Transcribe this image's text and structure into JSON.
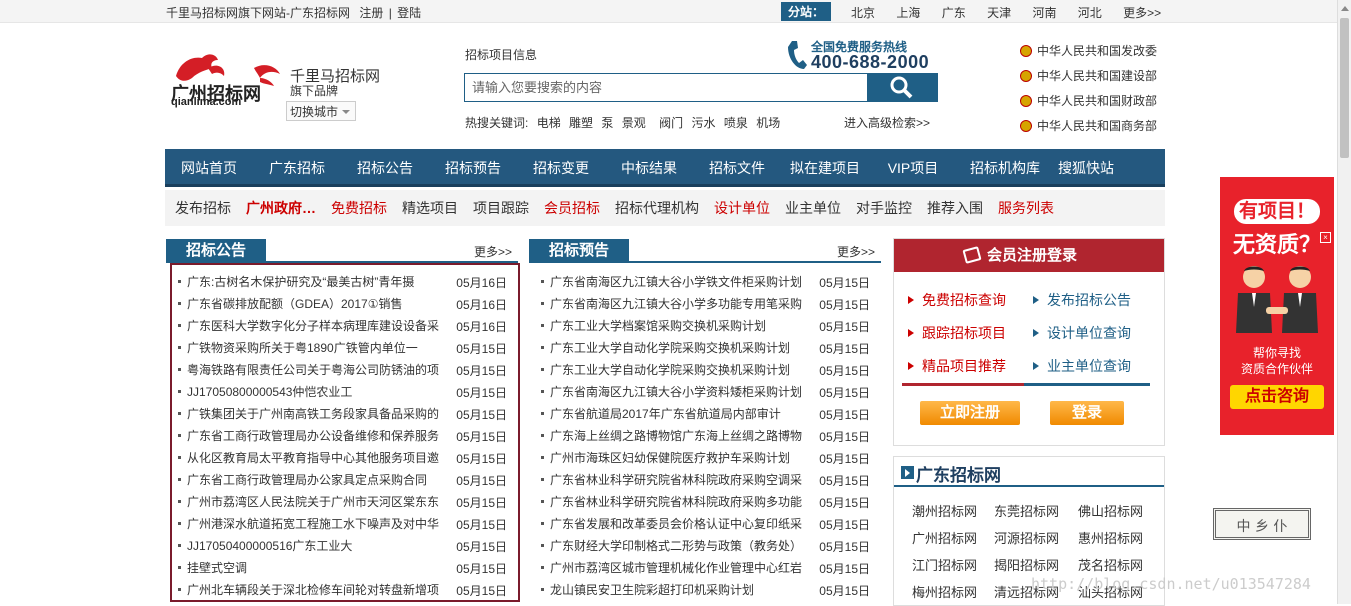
{
  "topbar": {
    "site_desc": "千里马招标网旗下网站-广东招标网",
    "register": "注册",
    "sep": "|",
    "login": "登陆",
    "branch_label": "分站：",
    "cities": [
      "北京",
      "上海",
      "广东",
      "天津",
      "河南",
      "河北"
    ],
    "more": "更多>>"
  },
  "header": {
    "logo_text": "广州招标网",
    "logo_domain": "qianlima.com",
    "brand_name": "千里马招标网",
    "brand_sub": "旗下品牌",
    "switch_city": "切换城市",
    "search_label": "招标项目信息",
    "search_placeholder": "请输入您要搜索的内容",
    "hot_label": "热搜关键词:",
    "hot_keywords": [
      "电梯",
      "雕塑",
      "泵",
      "景观",
      "阀门",
      "污水",
      "喷泉",
      "机场"
    ],
    "advanced_search": "进入高级检索>>",
    "hotline_title": "全国免费服务热线",
    "hotline_number": "400-688-2000",
    "gov_links": [
      "中华人民共和国发改委",
      "中华人民共和国建设部",
      "中华人民共和国财政部",
      "中华人民共和国商务部"
    ]
  },
  "main_nav": [
    "网站首页",
    "广东招标",
    "招标公告",
    "招标预告",
    "招标变更",
    "中标结果",
    "招标文件",
    "拟在建项目",
    "VIP项目",
    "招标机构库",
    "搜狐快站"
  ],
  "sub_nav": [
    {
      "label": "发布招标",
      "style": "normal"
    },
    {
      "label": "广州政府…",
      "style": "red-bold"
    },
    {
      "label": "免费招标",
      "style": "red"
    },
    {
      "label": "精选项目",
      "style": "normal"
    },
    {
      "label": "项目跟踪",
      "style": "normal"
    },
    {
      "label": "会员招标",
      "style": "red"
    },
    {
      "label": "招标代理机构",
      "style": "normal"
    },
    {
      "label": "设计单位",
      "style": "red"
    },
    {
      "label": "业主单位",
      "style": "normal"
    },
    {
      "label": "对手监控",
      "style": "normal"
    },
    {
      "label": "推荐入围",
      "style": "normal"
    },
    {
      "label": "服务列表",
      "style": "red"
    }
  ],
  "announcements": {
    "title": "招标公告",
    "more": "更多>>",
    "items": [
      {
        "title": "广东:古树名木保护研究及“最美古树”青年摄",
        "date": "05月16日"
      },
      {
        "title": "广东省碳排放配额（GDEA）2017①销售",
        "date": "05月16日"
      },
      {
        "title": "广东医科大学数字化分子样本病理库建设设备采",
        "date": "05月16日"
      },
      {
        "title": "广铁物资采购所关于粤1890广铁管内单位一",
        "date": "05月15日"
      },
      {
        "title": "粤海铁路有限责任公司关于粤海公司防锈油的项",
        "date": "05月15日"
      },
      {
        "title": "JJ17050800000543仲恺农业工",
        "date": "05月15日"
      },
      {
        "title": "广铁集团关于广州南高铁工务段家具备品采购的",
        "date": "05月15日"
      },
      {
        "title": "广东省工商行政管理局办公设备维修和保养服务",
        "date": "05月15日"
      },
      {
        "title": "从化区教育局太平教育指导中心其他服务项目邀",
        "date": "05月15日"
      },
      {
        "title": "广东省工商行政管理局办公家具定点采购合同",
        "date": "05月15日"
      },
      {
        "title": "广州市荔湾区人民法院关于广州市天河区棠东东",
        "date": "05月15日"
      },
      {
        "title": "广州港深水航道拓宽工程施工水下噪声及对中华",
        "date": "05月15日"
      },
      {
        "title": "JJ17050400000516广东工业大",
        "date": "05月15日"
      },
      {
        "title": "挂壁式空调",
        "date": "05月15日"
      },
      {
        "title": "广州北车辆段关于深北检修车间轮对转盘新增项",
        "date": "05月15日"
      }
    ]
  },
  "previews": {
    "title": "招标预告",
    "more": "更多>>",
    "items": [
      {
        "title": "广东省南海区九江镇大谷小学铁文件柜采购计划",
        "date": "05月15日"
      },
      {
        "title": "广东省南海区九江镇大谷小学多功能专用笔采购",
        "date": "05月15日"
      },
      {
        "title": "广东工业大学档案馆采购交换机采购计划",
        "date": "05月15日"
      },
      {
        "title": "广东工业大学自动化学院采购交换机采购计划",
        "date": "05月15日"
      },
      {
        "title": "广东工业大学自动化学院采购交换机采购计划",
        "date": "05月15日"
      },
      {
        "title": "广东省南海区九江镇大谷小学资料矮柜采购计划",
        "date": "05月15日"
      },
      {
        "title": "广东省航道局2017年广东省航道局内部审计",
        "date": "05月15日"
      },
      {
        "title": "广东海上丝绸之路博物馆广东海上丝绸之路博物",
        "date": "05月15日"
      },
      {
        "title": "广州市海珠区妇幼保健院医疗救护车采购计划",
        "date": "05月15日"
      },
      {
        "title": "广东省林业科学研究院省林科院政府采购空调采",
        "date": "05月15日"
      },
      {
        "title": "广东省林业科学研究院省林科院政府采购多功能",
        "date": "05月15日"
      },
      {
        "title": "广东省发展和改革委员会价格认证中心复印纸采",
        "date": "05月15日"
      },
      {
        "title": "广东财经大学印制格式二形势与政策（教务处）",
        "date": "05月15日"
      },
      {
        "title": "广州市荔湾区城市管理机械化作业管理中心红岩",
        "date": "05月15日"
      },
      {
        "title": "龙山镇民安卫生院彩超打印机采购计划",
        "date": "05月15日"
      }
    ]
  },
  "member": {
    "title": "会员注册登录",
    "links": [
      {
        "label": "免费招标查询",
        "color": "red"
      },
      {
        "label": "发布招标公告",
        "color": "blue"
      },
      {
        "label": "跟踪招标项目",
        "color": "red"
      },
      {
        "label": "设计单位查询",
        "color": "blue"
      },
      {
        "label": "精品项目推荐",
        "color": "red"
      },
      {
        "label": "业主单位查询",
        "color": "blue"
      }
    ],
    "register_btn": "立即注册",
    "login_btn": "登录"
  },
  "guangdong": {
    "title": "广东招标网",
    "links": [
      "潮州招标网",
      "东莞招标网",
      "佛山招标网",
      "广州招标网",
      "河源招标网",
      "惠州招标网",
      "江门招标网",
      "揭阳招标网",
      "茂名招标网",
      "梅州招标网",
      "清远招标网",
      "汕头招标网"
    ]
  },
  "ad": {
    "line1": "有项目！",
    "line2": "无资质？",
    "line3": "帮你寻找",
    "line4": "资质合作伙伴",
    "button": "点击咨询"
  },
  "stamp_text": "中 乡 仆",
  "watermark": "http://blog.csdn.net/u013547284",
  "colors": {
    "nav_blue": "#24587f",
    "accent_red": "#b0252f",
    "link_red": "#cc0000"
  }
}
